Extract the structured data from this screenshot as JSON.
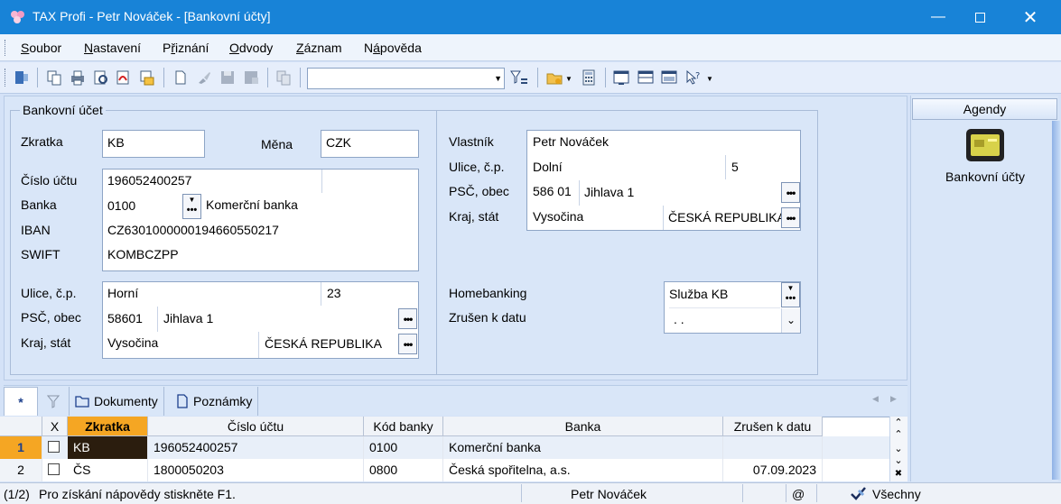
{
  "window": {
    "title": "TAX Profi - Petr Nováček - [Bankovní účty]"
  },
  "menu": [
    {
      "pre": "",
      "u": "S",
      "post": "oubor"
    },
    {
      "pre": "",
      "u": "N",
      "post": "astavení"
    },
    {
      "pre": "P",
      "u": "ř",
      "post": "iznání"
    },
    {
      "pre": "",
      "u": "O",
      "post": "dvody"
    },
    {
      "pre": "",
      "u": "Z",
      "post": "áznam"
    },
    {
      "pre": "N",
      "u": "á",
      "post": "pověda"
    }
  ],
  "form": {
    "group_title": "Bankovní účet",
    "labels": {
      "zkratka": "Zkratka",
      "mena": "Měna",
      "cislo_uctu": "Číslo účtu",
      "banka": "Banka",
      "iban": "IBAN",
      "swift": "SWIFT",
      "ulice": "Ulice, č.p.",
      "psc": "PSČ, obec",
      "kraj": "Kraj, stát",
      "vlastnik": "Vlastník",
      "homebanking": "Homebanking",
      "zruseno": "Zrušen k datu"
    },
    "zkratka": "KB",
    "mena": "CZK",
    "cislo_uctu": "196052400257",
    "banka_kod": "0100",
    "banka_nazev": "Komerční banka",
    "iban": "CZ6301000000194660550217",
    "swift": "KOMBCZPP",
    "bank_ulice": "Horní",
    "bank_cp": "23",
    "bank_psc": "58601",
    "bank_obec": "Jihlava 1",
    "bank_kraj": "Vysočina",
    "bank_stat": "ČESKÁ REPUBLIKA",
    "vlastnik": "Petr Nováček",
    "own_ulice": "Dolní",
    "own_cp": "5",
    "own_psc": "586 01",
    "own_obec": "Jihlava 1",
    "own_kraj": "Vysočina",
    "own_stat": "ČESKÁ REPUBLIKA",
    "homebanking": "Služba KB",
    "zruseno": ". ."
  },
  "side": {
    "header": "Agendy",
    "item": "Bankovní účty"
  },
  "tabs": {
    "new": "*",
    "dokumenty": "Dokumenty",
    "poznamky": "Poznámky"
  },
  "grid": {
    "headers": {
      "x": "X",
      "zkratka": "Zkratka",
      "cislo": "Číslo účtu",
      "kod": "Kód banky",
      "banka": "Banka",
      "zruseno": "Zrušen k datu"
    },
    "rows": [
      {
        "n": "1",
        "zkratka": "KB",
        "cislo": "196052400257",
        "kod": "0100",
        "banka": "Komerční banka",
        "zruseno": ""
      },
      {
        "n": "2",
        "zkratka": "ČS",
        "cislo": "1800050203",
        "kod": "0800",
        "banka": "Česká spořitelna, a.s.",
        "zruseno": "07.09.2023"
      }
    ]
  },
  "status": {
    "pos": "(1/2)",
    "hint": "Pro získání nápovědy stiskněte F1.",
    "user": "Petr Nováček",
    "at": "@",
    "filter": "Všechny"
  },
  "colors": {
    "titlebar": "#1883d7",
    "panel": "#d9e6f8",
    "selected_header": "#f5a623",
    "selected_row": "#2b1d0e"
  }
}
